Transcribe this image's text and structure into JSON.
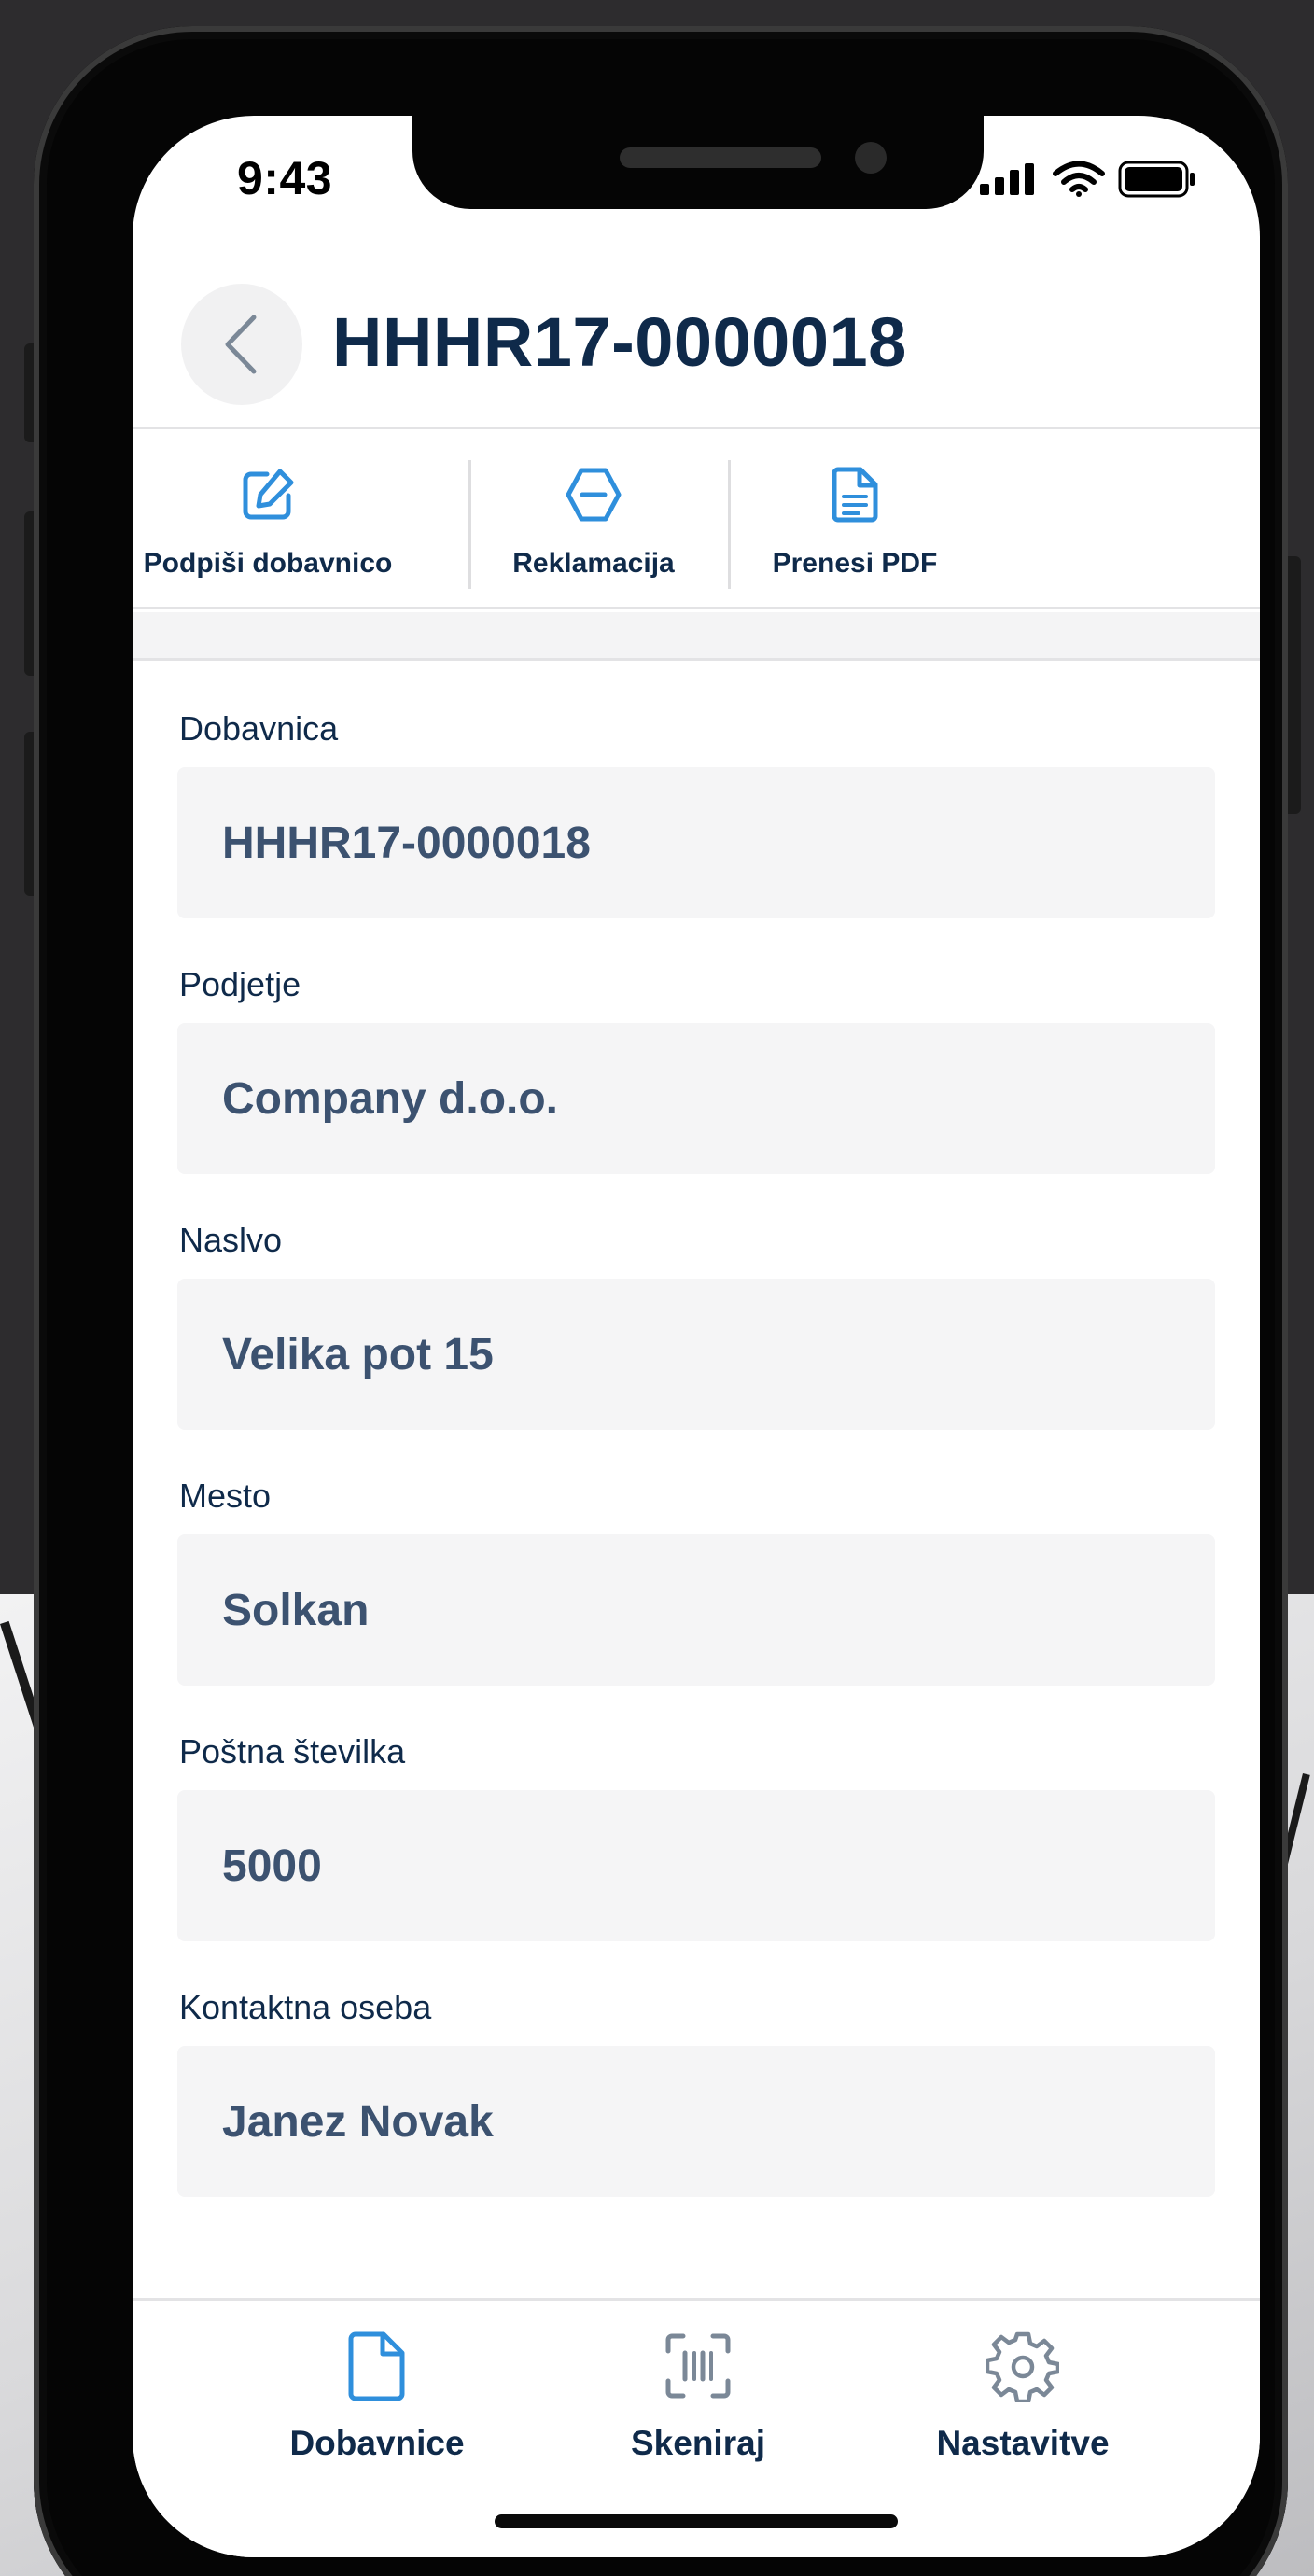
{
  "status_bar": {
    "time": "9:43"
  },
  "header": {
    "title": "HHHR17-0000018",
    "back_icon": "chevron-left-icon"
  },
  "toolbar": {
    "actions": [
      {
        "label": "Podpiši dobavnico",
        "icon": "edit-icon"
      },
      {
        "label": "Reklamacija",
        "icon": "stop-sign-icon"
      },
      {
        "label": "Prenesi PDF",
        "icon": "document-icon"
      }
    ]
  },
  "form": {
    "fields": [
      {
        "label": "Dobavnica",
        "value": "HHHR17-0000018"
      },
      {
        "label": "Podjetje",
        "value": "Company d.o.o."
      },
      {
        "label": "Naslvo",
        "value": "Velika pot 15"
      },
      {
        "label": "Mesto",
        "value": "Solkan"
      },
      {
        "label": "Poštna številka",
        "value": "5000"
      },
      {
        "label": "Kontaktna oseba",
        "value": "Janez Novak"
      }
    ]
  },
  "tabbar": {
    "tabs": [
      {
        "label": "Dobavnice",
        "icon": "file-icon",
        "active": true
      },
      {
        "label": "Skeniraj",
        "icon": "barcode-scan-icon",
        "active": false
      },
      {
        "label": "Nastavitve",
        "icon": "gear-icon",
        "active": false
      }
    ]
  },
  "colors": {
    "accent": "#2f8fdc",
    "text_dark": "#0f2a4a",
    "field_value": "#3c5270",
    "field_bg": "#f5f5f6"
  }
}
